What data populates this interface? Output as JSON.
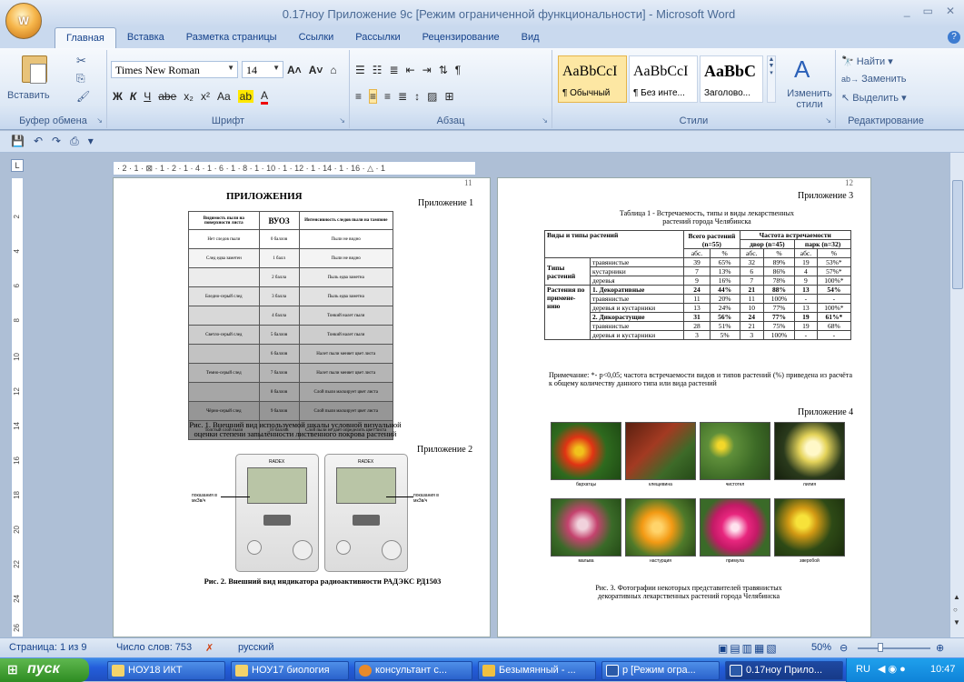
{
  "window": {
    "title": "0.17ноу Приложение 9с [Режим ограниченной функциональности] - Microsoft Word",
    "office_button": "W",
    "controls": [
      "_",
      "▭",
      "✕"
    ]
  },
  "ribbon": {
    "tabs": [
      "Главная",
      "Вставка",
      "Разметка страницы",
      "Ссылки",
      "Рассылки",
      "Рецензирование",
      "Вид"
    ],
    "active_tab": "Главная",
    "clipboard": {
      "paste": "Вставить",
      "label": "Буфер обмена"
    },
    "font": {
      "name": "Times New Roman",
      "size": "14",
      "label": "Шрифт"
    },
    "paragraph": {
      "label": "Абзац"
    },
    "styles": {
      "label": "Стили",
      "items": [
        {
          "sample": "AaBbCcI",
          "name": "¶ Обычный"
        },
        {
          "sample": "AaBbCcI",
          "name": "¶ Без инте..."
        },
        {
          "sample": "AaBbC",
          "name": "Заголово..."
        }
      ],
      "change": "Изменить стили"
    },
    "editing": {
      "find": "Найти",
      "replace": "Заменить",
      "select": "Выделить",
      "label": "Редактирование"
    }
  },
  "ruler_text": "· 2 · 1 · ⊠ · 1 · 2 · 1 · 4 · 1 · 6 · 1 · 8 · 1 · 10 · 1 · 12 · 1 · 14 · 1 · 16 · △ · 1",
  "vruler": [
    "2",
    "4",
    "6",
    "8",
    "10",
    "12",
    "14",
    "16",
    "18",
    "20",
    "22",
    "24",
    "26"
  ],
  "page_left": {
    "number": "11",
    "heading": "ПРИЛОЖЕНИЯ",
    "appendix1": "Приложение 1",
    "scale_headers": [
      "Видимость пыли на поверхности листа",
      "ВУОЗ",
      "Интенсивность следов пыли на тампоне"
    ],
    "scale_rows": [
      [
        "Нет следов пыли",
        "0 баллов",
        "Пыли не видно"
      ],
      [
        "След едва заметен",
        "1 балл",
        "Пыли не видно"
      ],
      [
        "",
        "2 балла",
        "Пыль едва заметна"
      ],
      [
        "Бледно-серый след",
        "3 балла",
        "Пыль едва заметна"
      ],
      [
        "",
        "4 балла",
        "Тонкий налет пыли"
      ],
      [
        "Светло-серый след",
        "5 баллов",
        "Тонкий налет пыли"
      ],
      [
        "",
        "6 баллов",
        "Налет пыли меняет цвет листа"
      ],
      [
        "Темно-серый след",
        "7 баллов",
        "Налет пыли меняет цвет листа"
      ],
      [
        "",
        "8 баллов",
        "Слой пыли маскирует цвет листа"
      ],
      [
        "Чёрно-серый след",
        "9 баллов",
        "Слой пыли маскирует цвет листа"
      ],
      [
        "Толстый слой пыли",
        "10 баллов",
        "Слой пыли не даёт определить цвет листа"
      ]
    ],
    "fig1_caption": "Рис. 1. Внешний вид используемой шкалы условной визуальной оценки степени запылённости лиственного покрова растений",
    "appendix2": "Приложение 2",
    "device_label_left": "показания в мкЗв/ч",
    "device_label_right": "показания в мкЗв/ч",
    "device_brand": "RADEX",
    "fig2_caption": "Рис. 2. Внешний вид индикатора радиоактивности РАДЭКС РД1503"
  },
  "page_right": {
    "number": "12",
    "appendix3": "Приложение 3",
    "table_title": "Таблица 1 - Встречаемость, типы и виды лекарственных растений города Челябинска",
    "table": {
      "h1": [
        "Виды и типы растений",
        "Всего растений (n=55)",
        "Частота встречаемости"
      ],
      "h2": [
        "двор (n=45)",
        "парк (n=32)"
      ],
      "h3": [
        "абс.",
        "%",
        "абс.",
        "%",
        "абс.",
        "%"
      ],
      "rows": [
        {
          "group": "Типы растений",
          "name": "травянистые",
          "v": [
            "39",
            "65%",
            "32",
            "89%",
            "19",
            "53%*"
          ]
        },
        {
          "group": "",
          "name": "кустарники",
          "v": [
            "7",
            "13%",
            "6",
            "86%",
            "4",
            "57%*"
          ]
        },
        {
          "group": "",
          "name": "деревья",
          "v": [
            "9",
            "16%",
            "7",
            "78%",
            "9",
            "100%*"
          ]
        },
        {
          "group": "Растения по примене-нию",
          "name": "1. Декоративные",
          "v": [
            "24",
            "44%",
            "21",
            "88%",
            "13",
            "54%"
          ],
          "bold": true
        },
        {
          "group": "",
          "name": "травянистые",
          "v": [
            "11",
            "20%",
            "11",
            "100%",
            "-",
            "-"
          ]
        },
        {
          "group": "",
          "name": "деревья и кустарники",
          "v": [
            "13",
            "24%",
            "10",
            "77%",
            "13",
            "100%*"
          ]
        },
        {
          "group": "",
          "name": "2. Дикорастущие",
          "v": [
            "31",
            "56%",
            "24",
            "77%",
            "19",
            "61%*"
          ],
          "bold": true
        },
        {
          "group": "",
          "name": "травянистые",
          "v": [
            "28",
            "51%",
            "21",
            "75%",
            "19",
            "68%"
          ]
        },
        {
          "group": "",
          "name": "деревья и кустарники",
          "v": [
            "3",
            "5%",
            "3",
            "100%",
            "-",
            "-"
          ]
        }
      ]
    },
    "note": "Примечание: *- p<0,05; частота встречаемости видов и типов растений (%) приведена из расчёта к общему количеству данного типа или вида растений",
    "appendix4": "Приложение 4",
    "photos": [
      "бархатцы",
      "клещевина",
      "чистотел",
      "лилия",
      "мальва",
      "настурция",
      "примула",
      "зверобой"
    ],
    "fig3_caption": "Рис. 3. Фотографии некоторых представителей травянистых декоративных лекарственных растений города Челябинска"
  },
  "statusbar": {
    "page": "Страница: 1 из 9",
    "words": "Число слов: 753",
    "lang": "русский",
    "zoom": "50%"
  },
  "taskbar": {
    "start": "пуск",
    "tasks": [
      "НОУ18 ИКТ",
      "НОУ17 биология",
      "консультант с...",
      "Безымянный - ...",
      "р [Режим огра...",
      "0.17ноу Прило..."
    ],
    "lang": "RU",
    "time": "10:47"
  }
}
